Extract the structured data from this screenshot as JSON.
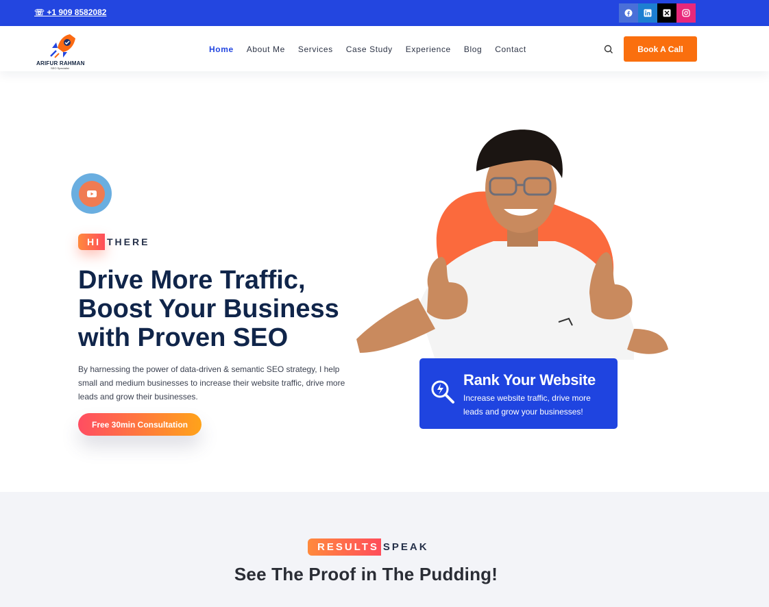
{
  "topbar": {
    "phone": "☏ +1 909 8582082",
    "socials": [
      {
        "icon": "facebook-icon",
        "color": "#4a6fd8"
      },
      {
        "icon": "linkedin-icon",
        "color": "#1d7fd1"
      },
      {
        "icon": "x-icon",
        "color": "#000000"
      },
      {
        "icon": "instagram-icon",
        "color": "#e8287b"
      }
    ]
  },
  "header": {
    "logo": {
      "name": "ARIFUR RAHMAN",
      "subtitle": "SEO Specialist"
    },
    "nav": [
      "Home",
      "About Me",
      "Services",
      "Case Study",
      "Experience",
      "Blog",
      "Contact"
    ],
    "active_nav": "Home",
    "book_button": "Book A Call"
  },
  "hero": {
    "tag_highlight": "HI",
    "tag_rest": "THERE",
    "title": "Drive More Traffic, Boost Your Business with Proven SEO",
    "description": "By harnessing the power of data-driven & semantic SEO strategy, I help small and medium businesses to increase their website traffic, drive more leads and grow their businesses.",
    "cta": "Free 30min Consultation",
    "card": {
      "title": "Rank Your Website",
      "description": "Increase website traffic, drive more leads and grow your businesses!"
    }
  },
  "results": {
    "tag_highlight": "RESULTS",
    "tag_rest": "SPEAK",
    "title": "See The Proof in The Pudding!"
  },
  "colors": {
    "brand_blue": "#2346e0",
    "accent_orange": "#fa6f0e",
    "heading_navy": "#10254a"
  }
}
